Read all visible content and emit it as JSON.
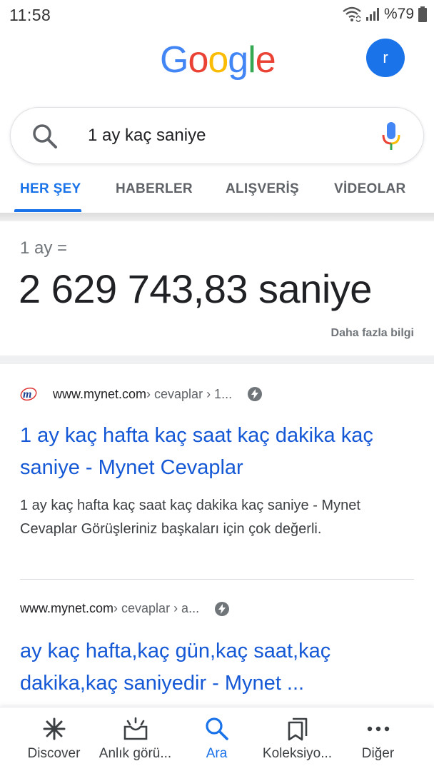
{
  "status_bar": {
    "time": "11:58",
    "battery": "%79"
  },
  "header": {
    "logo_letters": [
      {
        "char": "G",
        "color": "#4285F4"
      },
      {
        "char": "o",
        "color": "#EA4335"
      },
      {
        "char": "o",
        "color": "#FBBC05"
      },
      {
        "char": "g",
        "color": "#4285F4"
      },
      {
        "char": "l",
        "color": "#34A853"
      },
      {
        "char": "e",
        "color": "#EA4335"
      }
    ],
    "avatar_letter": "r"
  },
  "search": {
    "query": "1 ay kaç saniye"
  },
  "tabs": [
    {
      "label": "HER ŞEY",
      "active": true
    },
    {
      "label": "HABERLER",
      "active": false
    },
    {
      "label": "ALIŞVERİŞ",
      "active": false
    },
    {
      "label": "VİDEOLAR",
      "active": false
    }
  ],
  "answer": {
    "label": "1 ay =",
    "value": "2 629 743,83 saniye",
    "more_link": "Daha fazla bilgi"
  },
  "results": [
    {
      "domain": "www.mynet.com",
      "breadcrumb": " › cevaplar › 1...",
      "has_favicon": true,
      "title": "1 ay kaç hafta kaç saat kaç dakika kaç saniye - Mynet Cevaplar",
      "snippet": "1 ay kaç hafta kaç saat kaç dakika kaç saniye - Mynet Cevaplar Görüşleriniz başkaları için çok değerli."
    },
    {
      "domain": "www.mynet.com",
      "breadcrumb": " › cevaplar › a...",
      "has_favicon": false,
      "title": "ay kaç hafta,kaç gün,kaç saat,kaç dakika,kaç saniyedir - Mynet ...",
      "snippet": ""
    }
  ],
  "bottom_nav": [
    {
      "label": "Discover",
      "icon": "asterisk-icon",
      "active": false
    },
    {
      "label": "Anlık görü...",
      "icon": "snapshot-icon",
      "active": false
    },
    {
      "label": "Ara",
      "icon": "search-icon",
      "active": true
    },
    {
      "label": "Koleksiyo...",
      "icon": "collections-icon",
      "active": false
    },
    {
      "label": "Diğer",
      "icon": "more-icon",
      "active": false
    }
  ],
  "colors": {
    "accent": "#1a73e8",
    "link": "#1558d6"
  }
}
